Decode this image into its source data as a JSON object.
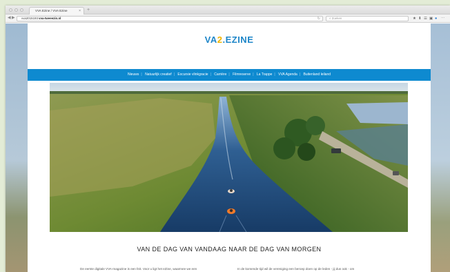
{
  "browser": {
    "tab_title": "VVA Ezine / VVA Ezine",
    "tab_close": "×",
    "new_tab": "+",
    "url_prefix": "vva2015193.",
    "url_host": "vva-tweeezin.nl",
    "reload_icon": "↻",
    "search_placeholder": "Zoeken",
    "back_icon": "◀",
    "forward_icon": "▶",
    "toolbar_icons": [
      "★",
      "⬇",
      "☰",
      "▣",
      "●",
      "⋯"
    ]
  },
  "site": {
    "logo_main": "VA",
    "logo_accent": "2",
    "logo_rest": ".EZINE",
    "nav": [
      "Nieuws",
      "Natuurlijk creatief",
      "Excursie vlinkgracie",
      "Carrière",
      "Filmreserve",
      "La Trappe",
      "VVA Agenda",
      "Buitenland leiland"
    ],
    "headline": "VAN DE DAG VAN VANDAAG NAAR DE DAG VAN MORGEN",
    "intro_left": "De eerste digitale VVA-magazine is een feit. Voor u ligt het eZine, waarmee we een",
    "intro_right": "In de komende tijd wil de vereniging een beroep doen op de leden - jij dus ook - om"
  },
  "colors": {
    "brand_blue": "#1e86c8",
    "nav_blue": "#0e8ad0",
    "logo_accent": "#f0b400"
  }
}
